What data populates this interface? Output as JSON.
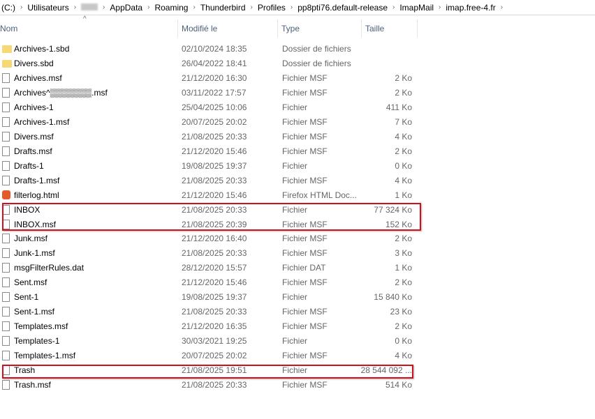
{
  "breadcrumb": [
    "(C:)",
    "Utilisateurs",
    "",
    "AppData",
    "Roaming",
    "Thunderbird",
    "Profiles",
    "pp8pti76.default-release",
    "ImapMail",
    "imap.free-4.fr"
  ],
  "columns": {
    "name": "Nom",
    "modified": "Modifié le",
    "type": "Type",
    "size": "Taille"
  },
  "files": [
    {
      "name": "Archives-1.sbd",
      "date": "02/10/2024 18:35",
      "type": "Dossier de fichiers",
      "size": "",
      "icon": "folder"
    },
    {
      "name": "Divers.sbd",
      "date": "26/04/2022 18:41",
      "type": "Dossier de fichiers",
      "size": "",
      "icon": "folder"
    },
    {
      "name": "Archives.msf",
      "date": "21/12/2020 16:30",
      "type": "Fichier MSF",
      "size": "2 Ko",
      "icon": "file"
    },
    {
      "name": "Archives^▒▒▒▒▒▒▒.msf",
      "date": "03/11/2022 17:57",
      "type": "Fichier MSF",
      "size": "2 Ko",
      "icon": "file"
    },
    {
      "name": "Archives-1",
      "date": "25/04/2025 10:06",
      "type": "Fichier",
      "size": "411 Ko",
      "icon": "file"
    },
    {
      "name": "Archives-1.msf",
      "date": "20/07/2025 20:02",
      "type": "Fichier MSF",
      "size": "7 Ko",
      "icon": "file"
    },
    {
      "name": "Divers.msf",
      "date": "21/08/2025 20:33",
      "type": "Fichier MSF",
      "size": "4 Ko",
      "icon": "file"
    },
    {
      "name": "Drafts.msf",
      "date": "21/12/2020 15:46",
      "type": "Fichier MSF",
      "size": "2 Ko",
      "icon": "file"
    },
    {
      "name": "Drafts-1",
      "date": "19/08/2025 19:37",
      "type": "Fichier",
      "size": "0 Ko",
      "icon": "file"
    },
    {
      "name": "Drafts-1.msf",
      "date": "21/08/2025 20:33",
      "type": "Fichier MSF",
      "size": "4 Ko",
      "icon": "file"
    },
    {
      "name": "filterlog.html",
      "date": "21/12/2020 15:46",
      "type": "Firefox HTML Doc...",
      "size": "1 Ko",
      "icon": "html"
    },
    {
      "name": "INBOX",
      "date": "21/08/2025 20:33",
      "type": "Fichier",
      "size": "77 324 Ko",
      "icon": "file"
    },
    {
      "name": "INBOX.msf",
      "date": "21/08/2025 20:39",
      "type": "Fichier MSF",
      "size": "152 Ko",
      "icon": "file"
    },
    {
      "name": "Junk.msf",
      "date": "21/12/2020 16:40",
      "type": "Fichier MSF",
      "size": "2 Ko",
      "icon": "file"
    },
    {
      "name": "Junk-1.msf",
      "date": "21/08/2025 20:33",
      "type": "Fichier MSF",
      "size": "3 Ko",
      "icon": "file"
    },
    {
      "name": "msgFilterRules.dat",
      "date": "28/12/2020 15:57",
      "type": "Fichier DAT",
      "size": "1 Ko",
      "icon": "file"
    },
    {
      "name": "Sent.msf",
      "date": "21/12/2020 15:46",
      "type": "Fichier MSF",
      "size": "2 Ko",
      "icon": "file"
    },
    {
      "name": "Sent-1",
      "date": "19/08/2025 19:37",
      "type": "Fichier",
      "size": "15 840 Ko",
      "icon": "file"
    },
    {
      "name": "Sent-1.msf",
      "date": "21/08/2025 20:33",
      "type": "Fichier MSF",
      "size": "23 Ko",
      "icon": "file"
    },
    {
      "name": "Templates.msf",
      "date": "21/12/2020 16:35",
      "type": "Fichier MSF",
      "size": "2 Ko",
      "icon": "file"
    },
    {
      "name": "Templates-1",
      "date": "30/03/2021 19:25",
      "type": "Fichier",
      "size": "0 Ko",
      "icon": "file"
    },
    {
      "name": "Templates-1.msf",
      "date": "20/07/2025 20:02",
      "type": "Fichier MSF",
      "size": "4 Ko",
      "icon": "file"
    },
    {
      "name": "Trash",
      "date": "21/08/2025 19:51",
      "type": "Fichier",
      "size": "28 544 092 ...",
      "icon": "file"
    },
    {
      "name": "Trash.msf",
      "date": "21/08/2025 20:33",
      "type": "Fichier MSF",
      "size": "514 Ko",
      "icon": "file"
    }
  ],
  "highlight_color": "#d0101a"
}
